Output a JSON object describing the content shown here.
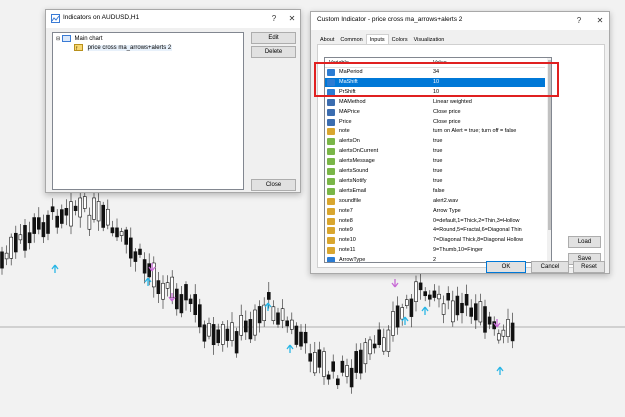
{
  "indicators_window": {
    "title": "Indicators on AUDUSD,H1",
    "help": "?",
    "close": "✕",
    "tree": {
      "root": "Main chart",
      "child": "price cross ma_arrows+alerts 2"
    },
    "buttons": {
      "edit": "Edit",
      "delete": "Delete",
      "close": "Close"
    }
  },
  "custom_indicator_window": {
    "title": "Custom Indicator - price cross ma_arrows+alerts 2",
    "help": "?",
    "close": "✕",
    "tabs": [
      "About",
      "Common",
      "Inputs",
      "Colors",
      "Visualization"
    ],
    "active_tab": "Inputs",
    "columns": {
      "variable": "Variable",
      "value": "Value"
    },
    "rows": [
      {
        "variable": "MaPeriod",
        "value": "34",
        "icon": "number-icon"
      },
      {
        "variable": "MaShift",
        "value": "10",
        "icon": "number-icon",
        "selected": true
      },
      {
        "variable": "PrShift",
        "value": "10",
        "icon": "number-icon"
      },
      {
        "variable": "MAMethod",
        "value": "Linear weighted",
        "icon": "enum-icon"
      },
      {
        "variable": "MAPrice",
        "value": "Close price",
        "icon": "enum-icon"
      },
      {
        "variable": "Price",
        "value": "Close price",
        "icon": "enum-icon"
      },
      {
        "variable": "note",
        "value": "turn on Alert = true; turn off = false",
        "icon": "string-icon"
      },
      {
        "variable": "alertsOn",
        "value": "true",
        "icon": "bool-icon"
      },
      {
        "variable": "alertsOnCurrent",
        "value": "true",
        "icon": "bool-icon"
      },
      {
        "variable": "alertsMessage",
        "value": "true",
        "icon": "bool-icon"
      },
      {
        "variable": "alertsSound",
        "value": "true",
        "icon": "bool-icon"
      },
      {
        "variable": "alertsNotify",
        "value": "true",
        "icon": "bool-icon"
      },
      {
        "variable": "alertsEmail",
        "value": "false",
        "icon": "bool-icon"
      },
      {
        "variable": "soundfile",
        "value": "alert2.wav",
        "icon": "string-icon"
      },
      {
        "variable": "note7",
        "value": "Arrow Type",
        "icon": "string-icon"
      },
      {
        "variable": "note8",
        "value": "0=default,1=Thick,2=Thin,3=Hollow",
        "icon": "string-icon"
      },
      {
        "variable": "note9",
        "value": "4=Round,5=Fractal,6=Diagonal Thin",
        "icon": "string-icon"
      },
      {
        "variable": "note10",
        "value": "7=Diagonal Thick,8=Diagonal Hollow",
        "icon": "string-icon"
      },
      {
        "variable": "note11",
        "value": "9=Thumb,10=Finger",
        "icon": "string-icon"
      },
      {
        "variable": "ArrowType",
        "value": "2",
        "icon": "number-icon"
      }
    ],
    "buttons": {
      "load": "Load",
      "save": "Save",
      "ok": "OK",
      "cancel": "Cancel",
      "reset": "Reset"
    }
  },
  "colors": {
    "highlight": "#e02020",
    "selection": "#0078d7",
    "arrow_up": "#29b6e6",
    "arrow_down": "#c86cd6"
  }
}
